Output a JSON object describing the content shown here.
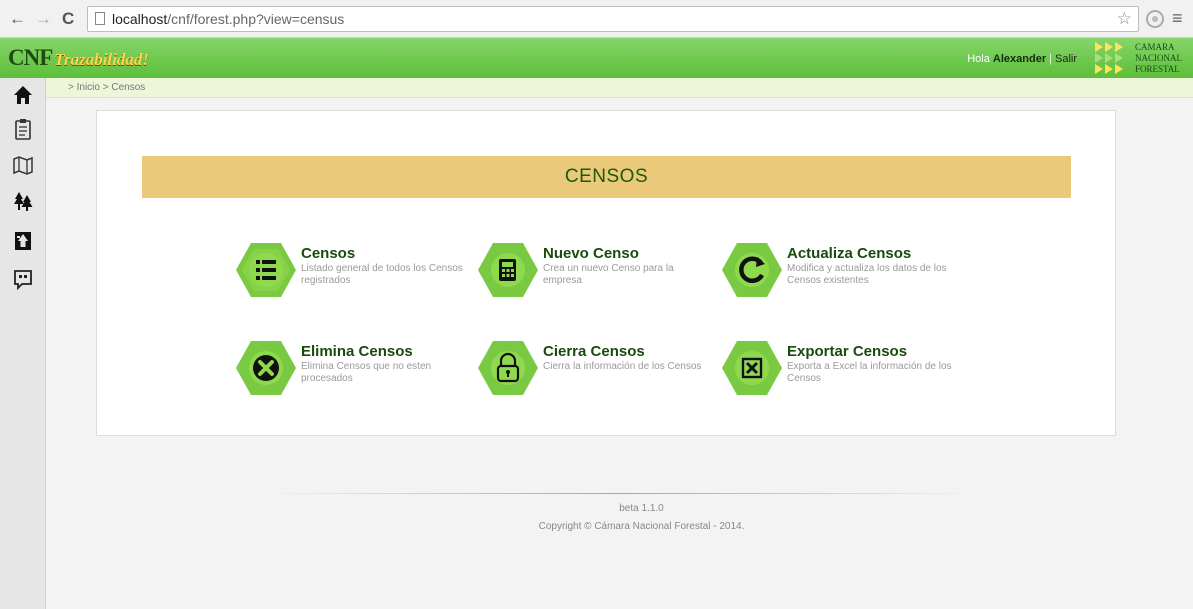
{
  "browser": {
    "url_host": "localhost",
    "url_path": "/cnf/forest.php?view=census"
  },
  "header": {
    "logo_cnf": "CNF",
    "logo_tagline": "Trazabilidad!",
    "greeting": "Hola",
    "user": "Alexander",
    "separator": "|",
    "logout": "Salir",
    "brand_lines": [
      "CAMARA",
      "NACIONAL",
      "FORESTAL"
    ]
  },
  "sidebar": {
    "icons": [
      "home-icon",
      "clipboard-icon",
      "map-icon",
      "trees-icon",
      "forest-sign-icon",
      "quote-icon"
    ]
  },
  "breadcrumb": "> Inicio > Censos",
  "main": {
    "title": "CENSOS",
    "tiles": [
      {
        "title": "Censos",
        "desc": "Listado general de todos los Censos registrados",
        "icon": "list-icon"
      },
      {
        "title": "Nuevo Censo",
        "desc": "Crea un nuevo Censo para la empresa",
        "icon": "register-icon"
      },
      {
        "title": "Actualiza Censos",
        "desc": "Modifica y actualiza los datos de los Censos existentes",
        "icon": "refresh-icon"
      },
      {
        "title": "Elimina Censos",
        "desc": "Elimina Censos que no esten procesados",
        "icon": "delete-icon"
      },
      {
        "title": "Cierra Censos",
        "desc": "Cierra la información de los Censos",
        "icon": "lock-icon"
      },
      {
        "title": "Exportar Censos",
        "desc": "Exporta a Excel la información de los Censos",
        "icon": "excel-icon"
      }
    ]
  },
  "footer": {
    "version": "beta 1.1.0",
    "copyright": "Copyright © Cámara Nacional Forestal - 2014."
  },
  "colors": {
    "header_green": "#5cbf3a",
    "hex_green": "#7ac943",
    "banner": "#ebc97a",
    "title_green": "#1a4b0e"
  }
}
